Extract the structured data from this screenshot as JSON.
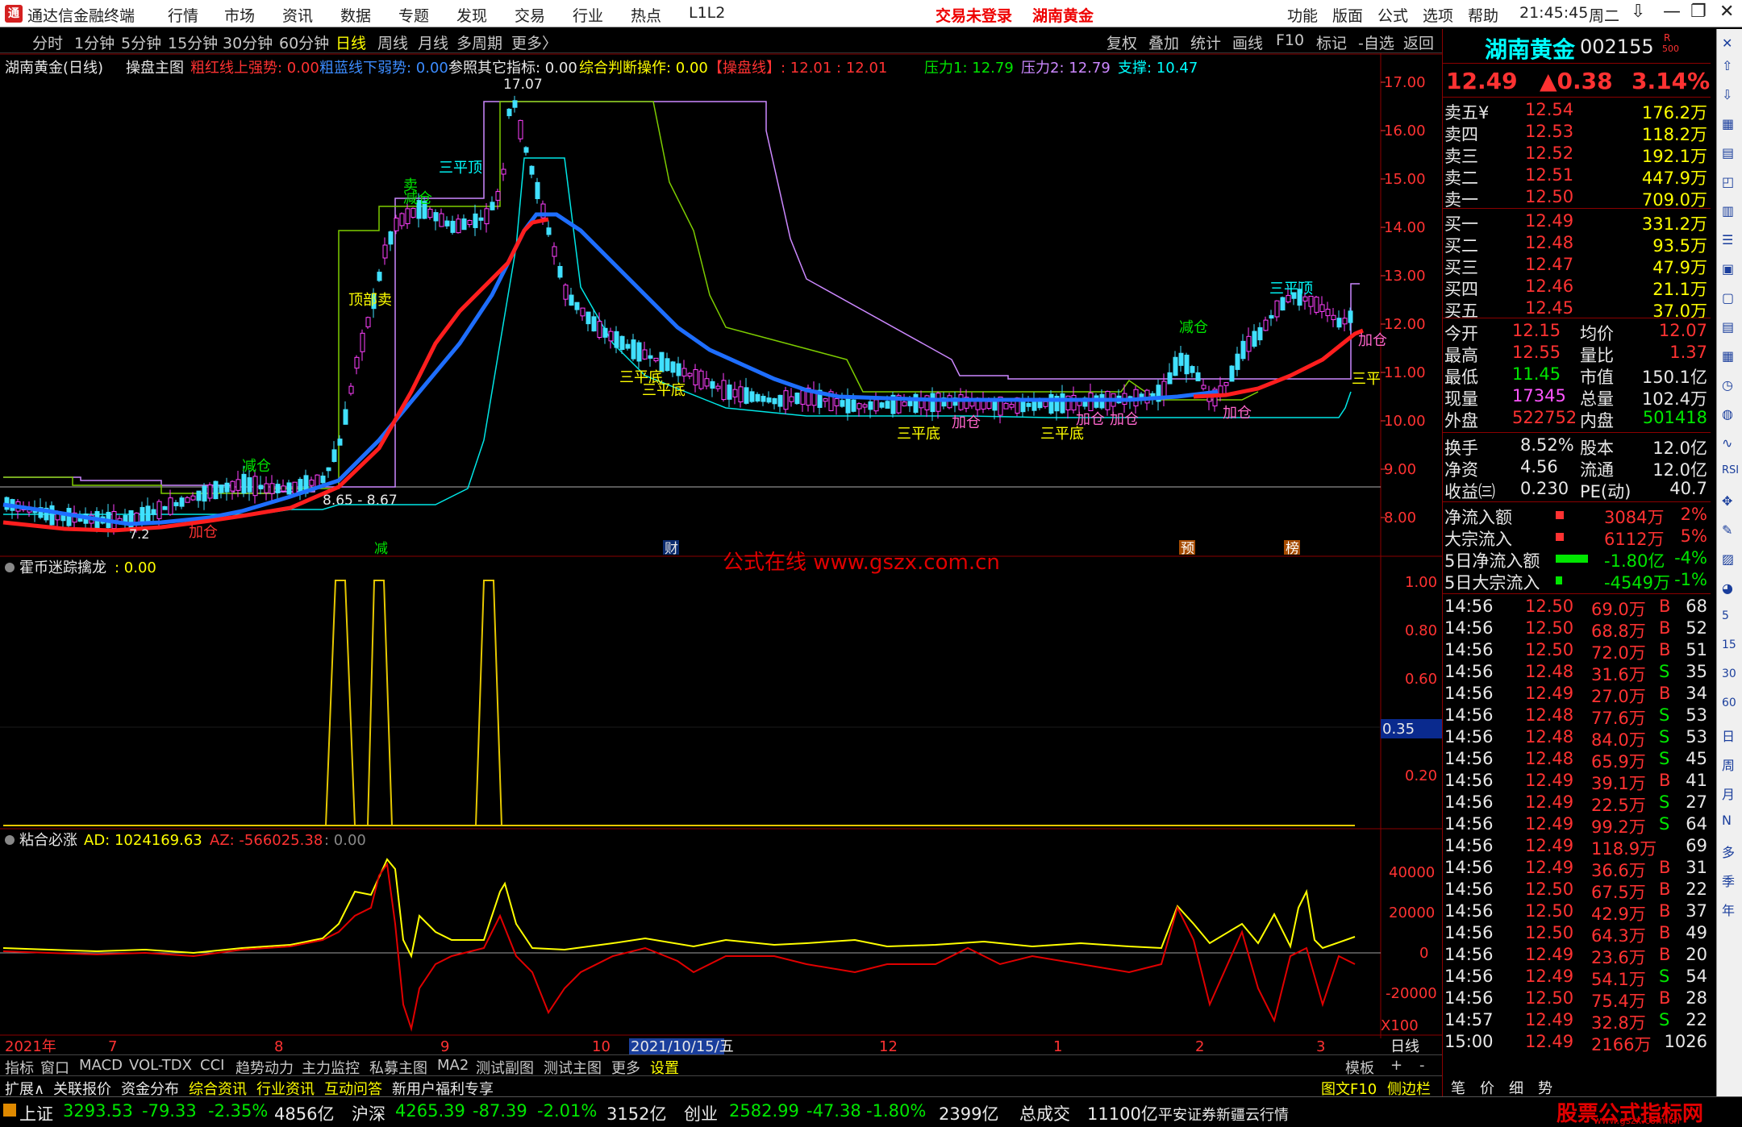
{
  "app": {
    "title": "通达信金融终端",
    "menus": [
      "行情",
      "市场",
      "资讯",
      "数据",
      "专题",
      "发现",
      "交易",
      "行业",
      "热点",
      "L1L2"
    ],
    "trade_status": "交易未登录",
    "stock_name_top": "湖南黄金",
    "right_menus": [
      "功能",
      "版面",
      "公式",
      "选项",
      "帮助"
    ],
    "clock": "21:45:45",
    "weekday": "周二",
    "window_controls": [
      "⇩",
      "—",
      "❐",
      "✕"
    ]
  },
  "toolbar": {
    "periods": [
      "分时",
      "1分钟",
      "5分钟",
      "15分钟",
      "30分钟",
      "60分钟",
      "日线",
      "周线",
      "月线",
      "多周期",
      "更多〉"
    ],
    "selected": "日线",
    "right_buttons": [
      "复权",
      "叠加",
      "统计",
      "画线",
      "F10",
      "标记",
      "-自选",
      "返回"
    ]
  },
  "main_panel": {
    "title": "湖南黄金(日线)",
    "formula": "操盘主图",
    "items": [
      {
        "text": "粗红线上强势: 0.00",
        "color": "#ff3232"
      },
      {
        "text": "粗蓝线下弱势: 0.00",
        "color": "#3c8cff"
      },
      {
        "text": "参照其它指标: 0.00",
        "color": "#e8e8e8"
      },
      {
        "text": "综合判断操作: 0.00",
        "color": "#ffff00"
      },
      {
        "text": "【操盘线】: 12.01 : 12.01",
        "color": "#ff3232"
      },
      {
        "text": "压力1: 12.79",
        "color": "#00e600"
      },
      {
        "text": "压力2: 12.79",
        "color": "#cc88ff"
      },
      {
        "text": "支撑: 10.47",
        "color": "#00ffff"
      }
    ],
    "price_axis": [
      "17.00",
      "16.00",
      "15.00",
      "14.00",
      "13.00",
      "12.00",
      "11.00",
      "10.00",
      "9.00",
      "8.00"
    ],
    "high_label": "17.07",
    "range_label": "8.65 - 8.67",
    "low_label": "7.2",
    "annotations": [
      {
        "text": "减仓",
        "color": "#00e600"
      },
      {
        "text": "加仓",
        "color": "#ff3232"
      },
      {
        "text": "卖",
        "color": "#00e600"
      },
      {
        "text": "减仓",
        "color": "#00e600"
      },
      {
        "text": "三平顶",
        "color": "#00ffff"
      },
      {
        "text": "顶部卖",
        "color": "#ffff00"
      },
      {
        "text": "三平底",
        "color": "#ffff00"
      },
      {
        "text": "三平底",
        "color": "#ffff00"
      },
      {
        "text": "三平底",
        "color": "#ffff00"
      },
      {
        "text": "三平底",
        "color": "#ffff00"
      },
      {
        "text": "加仓",
        "color": "#ff66cc"
      },
      {
        "text": "加仓",
        "color": "#ff66cc"
      },
      {
        "text": "加仓",
        "color": "#ff66cc"
      },
      {
        "text": "减仓",
        "color": "#00e600"
      },
      {
        "text": "加仓",
        "color": "#ff66cc"
      },
      {
        "text": "三平顶",
        "color": "#00ffff"
      },
      {
        "text": "加仓",
        "color": "#ff66cc"
      },
      {
        "text": "三平",
        "color": "#ffff00"
      }
    ],
    "event_markers": [
      "减",
      "财",
      "预",
      "榜"
    ],
    "watermark": "公式在线  www.gszx.com.cn"
  },
  "sub1": {
    "title": "霍币迷踪擒龙",
    "value": ": 0.00",
    "axis": [
      "1.00",
      "0.80",
      "0.60",
      "0.20"
    ],
    "cursor_value": "0.35"
  },
  "sub2": {
    "title": "粘合必涨",
    "ad": "AD: 1024169.63",
    "az": "AZ: -566025.38",
    "extra": ": 0.00",
    "axis": [
      "40000",
      "20000",
      "0",
      "-20000"
    ],
    "scale": "X100"
  },
  "date_axis": {
    "labels": [
      "2021年",
      "7",
      "8",
      "9",
      "10",
      "2021/10/15/五",
      "12",
      "1",
      "2",
      "3"
    ],
    "right": "日线"
  },
  "bottom_tabs": [
    "指标",
    "窗口",
    "MACD",
    "VOL-TDX",
    "CCI",
    "趋势动力",
    "主力监控",
    "私募主图",
    "MA2",
    "测试副图",
    "测试主图",
    "更多",
    "设置"
  ],
  "bottom_right": [
    "模板",
    "+",
    "-"
  ],
  "ext_bar": {
    "items": [
      "扩展∧",
      "关联报价",
      "资金分布",
      "综合资讯",
      "行业资讯",
      "互动问答",
      "新用户福利专享"
    ],
    "right": [
      "图文F10",
      "侧边栏《",
      "笔",
      "价",
      "细",
      "势"
    ]
  },
  "quote": {
    "name": "湖南黄金",
    "code": "002155",
    "badge": "R",
    "badge_sub": "500",
    "price": "12.49",
    "change": "▲0.38",
    "pct": "3.14%",
    "asks": [
      {
        "label": "卖五",
        "mark": "¥",
        "price": "12.54",
        "vol": "176.2万"
      },
      {
        "label": "卖四",
        "mark": "",
        "price": "12.53",
        "vol": "118.2万"
      },
      {
        "label": "卖三",
        "mark": "",
        "price": "12.52",
        "vol": "192.1万"
      },
      {
        "label": "卖二",
        "mark": "",
        "price": "12.51",
        "vol": "447.9万"
      },
      {
        "label": "卖一",
        "mark": "",
        "price": "12.50",
        "vol": "709.0万"
      }
    ],
    "bids": [
      {
        "label": "买一",
        "price": "12.49",
        "vol": "331.2万"
      },
      {
        "label": "买二",
        "price": "12.48",
        "vol": "93.5万"
      },
      {
        "label": "买三",
        "price": "12.47",
        "vol": "47.9万"
      },
      {
        "label": "买四",
        "price": "12.46",
        "vol": "21.1万"
      },
      {
        "label": "买五",
        "price": "12.45",
        "vol": "37.0万"
      }
    ],
    "stats": [
      {
        "l1": "今开",
        "v1": "12.15",
        "c1": "up",
        "l2": "均价",
        "v2": "12.07",
        "c2": "up"
      },
      {
        "l1": "最高",
        "v1": "12.55",
        "c1": "up",
        "l2": "量比",
        "v2": "1.37",
        "c2": "up"
      },
      {
        "l1": "最低",
        "v1": "11.45",
        "c1": "dn",
        "l2": "市值",
        "v2": "150.1亿",
        "c2": "wh"
      },
      {
        "l1": "现量",
        "v1": "17345",
        "c1": "mg",
        "l2": "总量",
        "v2": "102.4万",
        "c2": "wh"
      },
      {
        "l1": "外盘",
        "v1": "522752",
        "c1": "up",
        "l2": "内盘",
        "v2": "501418",
        "c2": "dn"
      }
    ],
    "fund": [
      {
        "l1": "换手",
        "v1": "8.52%",
        "l2": "股本",
        "v2": "12.0亿"
      },
      {
        "l1": "净资",
        "v1": "4.56",
        "l2": "流通",
        "v2": "12.0亿"
      },
      {
        "l1": "收益㈢",
        "v1": "0.230",
        "l2": "PE(动)",
        "v2": "40.7"
      }
    ],
    "flows": [
      {
        "label": "净流入额",
        "value": "3084万",
        "pct": "2%",
        "c": "up"
      },
      {
        "label": "大宗流入",
        "value": "6112万",
        "pct": "5%",
        "c": "up"
      },
      {
        "label": "5日净流入额",
        "value": "-1.80亿",
        "pct": "-4%",
        "c": "dn"
      },
      {
        "label": "5日大宗流入",
        "value": "-4549万",
        "pct": "-1%",
        "c": "dn"
      }
    ],
    "ticks": [
      {
        "t": "14:56",
        "p": "12.50",
        "v": "69.0万",
        "bs": "B",
        "n": "68"
      },
      {
        "t": "14:56",
        "p": "12.50",
        "v": "68.8万",
        "bs": "B",
        "n": "52"
      },
      {
        "t": "14:56",
        "p": "12.50",
        "v": "72.0万",
        "bs": "B",
        "n": "51"
      },
      {
        "t": "14:56",
        "p": "12.48",
        "v": "31.6万",
        "bs": "S",
        "n": "35"
      },
      {
        "t": "14:56",
        "p": "12.49",
        "v": "27.0万",
        "bs": "B",
        "n": "34"
      },
      {
        "t": "14:56",
        "p": "12.48",
        "v": "77.6万",
        "bs": "S",
        "n": "53"
      },
      {
        "t": "14:56",
        "p": "12.48",
        "v": "84.0万",
        "bs": "S",
        "n": "53"
      },
      {
        "t": "14:56",
        "p": "12.48",
        "v": "65.9万",
        "bs": "S",
        "n": "45"
      },
      {
        "t": "14:56",
        "p": "12.49",
        "v": "39.1万",
        "bs": "B",
        "n": "41"
      },
      {
        "t": "14:56",
        "p": "12.49",
        "v": "22.5万",
        "bs": "S",
        "n": "27"
      },
      {
        "t": "14:56",
        "p": "12.49",
        "v": "99.2万",
        "bs": "S",
        "n": "64"
      },
      {
        "t": "14:56",
        "p": "12.49",
        "v": "118.9万",
        "bs": "",
        "n": "69"
      },
      {
        "t": "14:56",
        "p": "12.49",
        "v": "36.6万",
        "bs": "B",
        "n": "31"
      },
      {
        "t": "14:56",
        "p": "12.50",
        "v": "67.5万",
        "bs": "B",
        "n": "22"
      },
      {
        "t": "14:56",
        "p": "12.50",
        "v": "42.9万",
        "bs": "B",
        "n": "37"
      },
      {
        "t": "14:56",
        "p": "12.50",
        "v": "64.3万",
        "bs": "B",
        "n": "49"
      },
      {
        "t": "14:56",
        "p": "12.49",
        "v": "23.6万",
        "bs": "B",
        "n": "20"
      },
      {
        "t": "14:56",
        "p": "12.49",
        "v": "54.1万",
        "bs": "S",
        "n": "54"
      },
      {
        "t": "14:56",
        "p": "12.50",
        "v": "75.4万",
        "bs": "B",
        "n": "28"
      },
      {
        "t": "14:57",
        "p": "12.49",
        "v": "32.8万",
        "bs": "S",
        "n": "22"
      },
      {
        "t": "15:00",
        "p": "12.49",
        "v": "2166万",
        "bs": "",
        "n": "1026"
      }
    ]
  },
  "sidebar_labels": [
    "日",
    "周",
    "月",
    "N",
    "多",
    "季",
    "年"
  ],
  "status": {
    "items": [
      {
        "name": "上证",
        "value": "3293.53",
        "chg": "-79.33",
        "pct": "-2.35%",
        "amt": "4856亿"
      },
      {
        "name": "沪深",
        "value": "4265.39",
        "chg": "-87.39",
        "pct": "-2.01%",
        "amt": "3152亿"
      },
      {
        "name": "创业",
        "value": "2582.99",
        "chg": "-47.38",
        "pct": "-1.80%",
        "amt": "2399亿"
      }
    ],
    "total_label": "总成交",
    "total_value": "11100亿",
    "broker": "平安证券新疆云行情",
    "brand": "股票公式指标网",
    "brand_url": "www.gszx.com.cn"
  },
  "colors": {
    "up": "#ff3232",
    "down": "#00e600",
    "frame": "#8b0000",
    "yellow": "#ffff00",
    "cyan": "#00ffff",
    "blue": "#1e6eff"
  }
}
